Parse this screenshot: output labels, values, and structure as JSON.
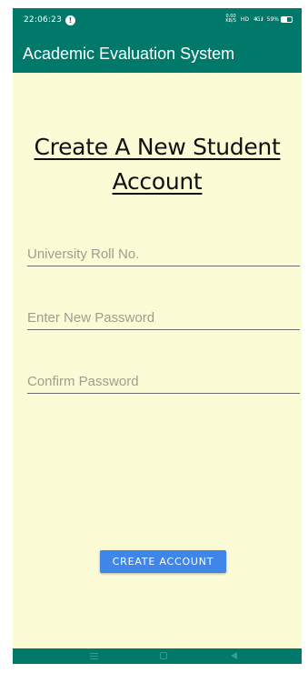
{
  "status_bar": {
    "time": "22:06:23",
    "alert_icon": "alert-circle-icon",
    "net_speed": "0.00\nKB/S",
    "network_type": "HD",
    "signal_text": "4G .ıl",
    "battery_percent": "59%",
    "battery_level": 0.59
  },
  "app_bar": {
    "title": "Academic Evaluation System",
    "background_color": "#00796b"
  },
  "page": {
    "background_color": "#fbfbd5",
    "title": "Create A New Student Account"
  },
  "form": {
    "roll_placeholder": "University Roll No.",
    "password_placeholder": "Enter New Password",
    "confirm_placeholder": "Confirm Password",
    "submit_label": "CREATE ACCOUNT",
    "submit_color": "#3f86e8"
  },
  "nav_bar": {
    "menu_icon": "menu-icon",
    "home_icon": "home-square-icon",
    "back_icon": "back-triangle-icon"
  }
}
